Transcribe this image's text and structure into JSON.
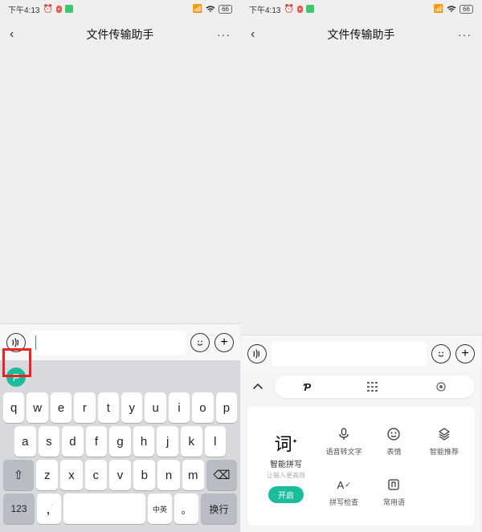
{
  "status": {
    "time": "下午4:13",
    "alarm_icon": "⏰",
    "battery": "66"
  },
  "chat": {
    "title": "文件传输助手",
    "back": "‹",
    "more": "···"
  },
  "input": {
    "voice": ")))",
    "emoji": "☺",
    "plus": "+"
  },
  "keyboard": {
    "row1": [
      "q",
      "w",
      "e",
      "r",
      "t",
      "y",
      "u",
      "i",
      "o",
      "p"
    ],
    "row2": [
      "a",
      "s",
      "d",
      "f",
      "g",
      "h",
      "j",
      "k",
      "l"
    ],
    "row3": [
      "z",
      "x",
      "c",
      "v",
      "b",
      "n",
      "m"
    ],
    "shift": "⇧",
    "backspace": "⌫",
    "num": "123",
    "comma": ",",
    "space": " ",
    "lang": "中英",
    "period": "。",
    "enter": "换行"
  },
  "panel": {
    "ci": "词",
    "ci_title": "智能拼写",
    "ci_sub": "让输入更高效",
    "enable": "开启",
    "cells": [
      {
        "icon": "mic",
        "label": "语音转文字"
      },
      {
        "icon": "smile",
        "label": "表情"
      },
      {
        "icon": "stack",
        "label": "智能推荐"
      },
      {
        "icon": "Aa",
        "label": "拼写检查"
      },
      {
        "icon": "phrase",
        "label": "常用语"
      },
      {
        "icon": "",
        "label": ""
      }
    ]
  }
}
